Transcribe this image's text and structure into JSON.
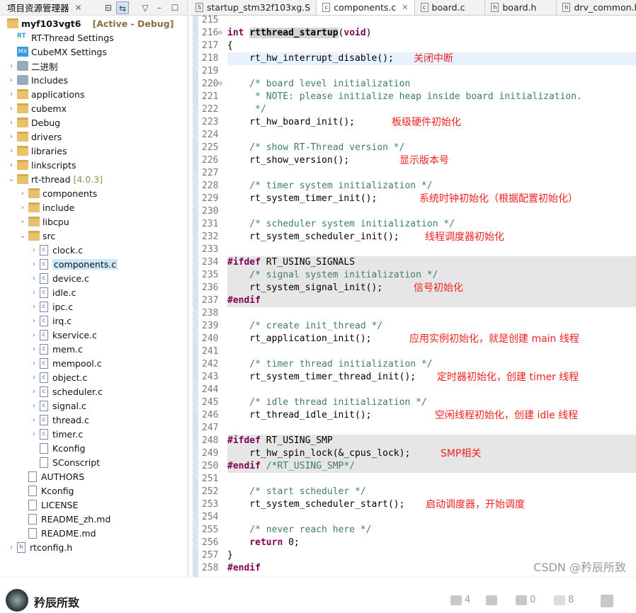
{
  "explorer": {
    "title": "项目资源管理器",
    "project": "myf103vgt6",
    "project_tag": "[Active - Debug]",
    "items": [
      {
        "label": "RT-Thread Settings",
        "lvl": 0,
        "type": "rt",
        "chev": ""
      },
      {
        "label": "CubeMX Settings",
        "lvl": 0,
        "type": "mx",
        "chev": ""
      },
      {
        "label": "二进制",
        "lvl": 0,
        "type": "bin",
        "chev": ">"
      },
      {
        "label": "Includes",
        "lvl": 0,
        "type": "inc",
        "chev": ">"
      },
      {
        "label": "applications",
        "lvl": 0,
        "type": "folder",
        "chev": ">"
      },
      {
        "label": "cubemx",
        "lvl": 0,
        "type": "folder",
        "chev": ">"
      },
      {
        "label": "Debug",
        "lvl": 0,
        "type": "folder",
        "chev": ">"
      },
      {
        "label": "drivers",
        "lvl": 0,
        "type": "folder",
        "chev": ">"
      },
      {
        "label": "libraries",
        "lvl": 0,
        "type": "folder",
        "chev": ">"
      },
      {
        "label": "linkscripts",
        "lvl": 0,
        "type": "folder",
        "chev": ">"
      },
      {
        "label": "rt-thread",
        "lvl": 0,
        "type": "folder",
        "chev": "v",
        "tag": "[4.0.3]"
      },
      {
        "label": "components",
        "lvl": 1,
        "type": "folder",
        "chev": ">"
      },
      {
        "label": "include",
        "lvl": 1,
        "type": "folder",
        "chev": ">"
      },
      {
        "label": "libcpu",
        "lvl": 1,
        "type": "folder",
        "chev": ">"
      },
      {
        "label": "src",
        "lvl": 1,
        "type": "folder",
        "chev": "v"
      },
      {
        "label": "clock.c",
        "lvl": 2,
        "type": "c",
        "chev": ">"
      },
      {
        "label": "components.c",
        "lvl": 2,
        "type": "c",
        "chev": ">",
        "selected": true
      },
      {
        "label": "device.c",
        "lvl": 2,
        "type": "c",
        "chev": ">"
      },
      {
        "label": "idle.c",
        "lvl": 2,
        "type": "c",
        "chev": ">"
      },
      {
        "label": "ipc.c",
        "lvl": 2,
        "type": "c",
        "chev": ">"
      },
      {
        "label": "irq.c",
        "lvl": 2,
        "type": "c",
        "chev": ">"
      },
      {
        "label": "kservice.c",
        "lvl": 2,
        "type": "c",
        "chev": ">"
      },
      {
        "label": "mem.c",
        "lvl": 2,
        "type": "c",
        "chev": ">"
      },
      {
        "label": "mempool.c",
        "lvl": 2,
        "type": "c",
        "chev": ">"
      },
      {
        "label": "object.c",
        "lvl": 2,
        "type": "c",
        "chev": ">"
      },
      {
        "label": "scheduler.c",
        "lvl": 2,
        "type": "c",
        "chev": ">"
      },
      {
        "label": "signal.c",
        "lvl": 2,
        "type": "c",
        "chev": ">"
      },
      {
        "label": "thread.c",
        "lvl": 2,
        "type": "c",
        "chev": ">"
      },
      {
        "label": "timer.c",
        "lvl": 2,
        "type": "c",
        "chev": ">"
      },
      {
        "label": "Kconfig",
        "lvl": 2,
        "type": "file",
        "chev": ""
      },
      {
        "label": "SConscript",
        "lvl": 2,
        "type": "file",
        "chev": ""
      },
      {
        "label": "AUTHORS",
        "lvl": 1,
        "type": "file",
        "chev": ""
      },
      {
        "label": "Kconfig",
        "lvl": 1,
        "type": "file",
        "chev": ""
      },
      {
        "label": "LICENSE",
        "lvl": 1,
        "type": "file",
        "chev": ""
      },
      {
        "label": "README_zh.md",
        "lvl": 1,
        "type": "file",
        "chev": ""
      },
      {
        "label": "README.md",
        "lvl": 1,
        "type": "file",
        "chev": ""
      },
      {
        "label": "rtconfig.h",
        "lvl": 0,
        "type": "h",
        "chev": ">"
      }
    ]
  },
  "tabs": [
    {
      "label": "startup_stm32f103xg.S",
      "icon": "S"
    },
    {
      "label": "components.c",
      "icon": "c",
      "active": true
    },
    {
      "label": "board.c",
      "icon": "c"
    },
    {
      "label": "board.h",
      "icon": "h"
    },
    {
      "label": "drv_common.h",
      "icon": "h"
    }
  ],
  "code": [
    {
      "n": "215",
      "t": ""
    },
    {
      "n": "216",
      "t": "int rtthread_startup(void)",
      "fold": true
    },
    {
      "n": "217",
      "t": "{"
    },
    {
      "n": "218",
      "t": "    rt_hw_interrupt_disable();",
      "note": "关闭中断",
      "nx": 316,
      "cur": true
    },
    {
      "n": "219",
      "t": ""
    },
    {
      "n": "220",
      "t": "    /* board level initialization",
      "fold": true
    },
    {
      "n": "221",
      "t": "     * NOTE: please initialize heap inside board initialization."
    },
    {
      "n": "222",
      "t": "     */"
    },
    {
      "n": "223",
      "t": "    rt_hw_board_init();",
      "note": "板级硬件初始化",
      "nx": 285
    },
    {
      "n": "224",
      "t": ""
    },
    {
      "n": "225",
      "t": "    /* show RT-Thread version */"
    },
    {
      "n": "226",
      "t": "    rt_show_version();",
      "note": "显示版本号",
      "nx": 296
    },
    {
      "n": "227",
      "t": ""
    },
    {
      "n": "228",
      "t": "    /* timer system initialization */"
    },
    {
      "n": "229",
      "t": "    rt_system_timer_init();",
      "note": "系统时钟初始化（根据配置初始化）",
      "nx": 324
    },
    {
      "n": "230",
      "t": ""
    },
    {
      "n": "231",
      "t": "    /* scheduler system initialization */"
    },
    {
      "n": "232",
      "t": "    rt_system_scheduler_init();",
      "note": "线程调度器初始化",
      "nx": 332
    },
    {
      "n": "233",
      "t": ""
    },
    {
      "n": "234",
      "t": "#ifdef RT_USING_SIGNALS",
      "gray": true
    },
    {
      "n": "235",
      "t": "    /* signal system initialization */",
      "gray": true
    },
    {
      "n": "236",
      "t": "    rt_system_signal_init();",
      "note": "信号初始化",
      "nx": 316,
      "gray": true
    },
    {
      "n": "237",
      "t": "#endif",
      "gray": true
    },
    {
      "n": "238",
      "t": ""
    },
    {
      "n": "239",
      "t": "    /* create init_thread */"
    },
    {
      "n": "240",
      "t": "    rt_application_init();",
      "note": "应用实例初始化，就是创建 main 线程",
      "nx": 310
    },
    {
      "n": "241",
      "t": ""
    },
    {
      "n": "242",
      "t": "    /* timer thread initialization */"
    },
    {
      "n": "243",
      "t": "    rt_system_timer_thread_init();",
      "note": "定时器初始化，创建 timer 线程",
      "nx": 349
    },
    {
      "n": "244",
      "t": ""
    },
    {
      "n": "245",
      "t": "    /* idle thread initialization */"
    },
    {
      "n": "246",
      "t": "    rt_thread_idle_init();",
      "note": "空闲线程初始化，创建 idle 线程",
      "nx": 346
    },
    {
      "n": "247",
      "t": ""
    },
    {
      "n": "248",
      "t": "#ifdef RT_USING_SMP",
      "gray": true
    },
    {
      "n": "249",
      "t": "    rt_hw_spin_lock(&_cpus_lock);",
      "note": "SMP相关",
      "nx": 354,
      "gray": true
    },
    {
      "n": "250",
      "t": "#endif /*RT_USING_SMP*/",
      "gray": true
    },
    {
      "n": "251",
      "t": ""
    },
    {
      "n": "252",
      "t": "    /* start scheduler */"
    },
    {
      "n": "253",
      "t": "    rt_system_scheduler_start();",
      "note": "启动调度器，开始调度",
      "nx": 333
    },
    {
      "n": "254",
      "t": ""
    },
    {
      "n": "255",
      "t": "    /* never reach here */"
    },
    {
      "n": "256",
      "t": "    return 0;"
    },
    {
      "n": "257",
      "t": "}"
    },
    {
      "n": "258",
      "t": "#endif"
    }
  ],
  "watermark": "CSDN @矜辰所致",
  "footer": {
    "author": "矜辰所致",
    "likes": "4",
    "comments": "0",
    "favorites": "8"
  }
}
